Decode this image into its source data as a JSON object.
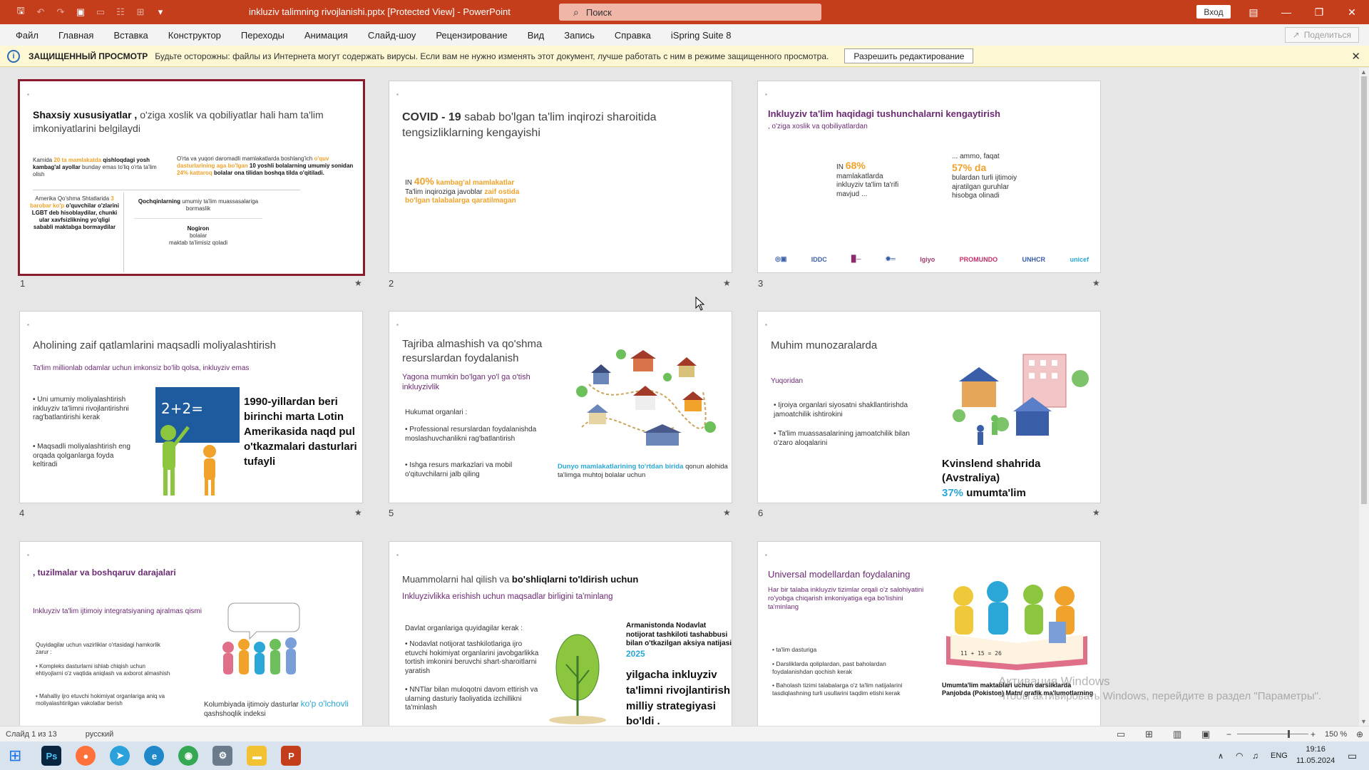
{
  "titlebar": {
    "doc_title": "inkluziv talimning rivojlanishi.pptx [Protected View] - PowerPoint",
    "search_placeholder": "Поиск",
    "signin": "Вход"
  },
  "ribbon": {
    "tabs": [
      "Файл",
      "Главная",
      "Вставка",
      "Конструктор",
      "Переходы",
      "Анимация",
      "Слайд-шоу",
      "Рецензирование",
      "Вид",
      "Запись",
      "Справка",
      "iSpring Suite 8"
    ],
    "share": "Поделиться"
  },
  "message_bar": {
    "label": "ЗАЩИЩЕННЫЙ ПРОСМОТР",
    "text": "Будьте осторожны: файлы из Интернета могут содержать вирусы. Если вам не нужно изменять этот документ, лучше работать с ним в режиме защищенного просмотра.",
    "button": "Разрешить редактирование"
  },
  "slides": {
    "s1": {
      "num": "1",
      "title_bold": "Shaxsiy xususiyatlar ,",
      "title_rest": " o'ziga xoslik va qobiliyatlar hali ham ta'lim imkoniyatlarini belgilaydi",
      "b1a": "Kamida ",
      "b1b": "20 ta mamlakatda",
      "b1c": " qishloqdagi yosh kambag'al ayollar",
      "b1d": " bunday emas to'liq o'rta ta'lim olish",
      "b2a": "O'rta va yuqori daromadli mamlakatlarda boshlang'ich ",
      "b2b": "o'quv dasturlarining aga bo'lgan ",
      "b2c": "10 yoshli bolalarning umumiy sonidan ",
      "b2d": "24% kattaroq",
      "b2e": " bolalar ona tilidan boshqa tilda o'qitiladi.",
      "b3a": "Amerika Qo'shma Shtatlarida ",
      "b3b": "3 barobar ko'p",
      "b3c": " o'quvchilar o'zlarini LGBT deb hisoblaydilar, chunki ular xavfsizlikning yo'qligi sababli maktabga bormaydilar",
      "b4a": "Qochqinlarning",
      "b4b": " umumiy ta'lim muassasalariga bormaslik",
      "b5a": "Nogiron",
      "b5b": "bolalar",
      "b5c": "maktab ta'limisiz qoladi"
    },
    "s2": {
      "num": "2",
      "title_a": "COVID - 19",
      "title_b": " sabab bo'lgan ta'lim inqirozi sharoitida tengsizliklarning kengayishi",
      "l1a": "IN ",
      "l1b": "40%",
      "l1c": " kambag'al mamlakatlar",
      "l2a": "Ta'lim inqiroziga javoblar ",
      "l2b": "zaif ostida",
      "l3": "bo'lgan talabalarga qaratilmagan"
    },
    "s3": {
      "num": "3",
      "title": "Inkluyziv ta'lim haqidagi tushunchalarni kengaytirish",
      "subtitle": ", o'ziga xoslik va qobiliyatlardan",
      "l1a": "IN ",
      "l1b": "68%",
      "l1c": "mamlakatlarda inkluyziv ta'lim ta'rifi mavjud ...",
      "r1": "... ammo, faqat",
      "r2": "57% da",
      "r3": "bulardan turli ijtimoiy ajratilgan guruhlar hisobga olinadi",
      "logos": [
        "IDDC",
        "Igiyo",
        "PROMUNDO",
        "UNHCR",
        "unicef"
      ]
    },
    "s4": {
      "num": "4",
      "title": "Aholining zaif qatlamlarini maqsadli moliyalashtirish",
      "subtitle": "Ta'lim millionlab odamlar uchun imkonsiz bo'lib qolsa, inkluyziv emas",
      "b1": "Uni umumiy moliyalashtirish inkluyziv ta'limni rivojlantirishni rag'batlantirishi kerak",
      "b2": "Maqsadli moliyalashtirish eng orqada qolganlarga foyda keltiradi",
      "board": "2+2=",
      "big": "1990-yillardan beri birinchi marta Lotin Amerikasida naqd pul o'tkazmalari dasturlari tufayli"
    },
    "s5": {
      "num": "5",
      "title": "Tajriba almashish va qo'shma resurslardan foydalanish",
      "subtitle": "Yagona mumkin bo'lgan yo'l ga o'tish inkluyzivlik",
      "head": "Hukumat organlari :",
      "b1": "Professional resurslardan foydalanishda moslashuvchanlikni rag'batlantirish",
      "b2": "Ishga resurs markazlari va mobil o'qituvchilarni jalb qiling",
      "foot_a": "Dunyo mamlakatlarining to'rtdan birida",
      "foot_b": " qonun alohida ta'limga muhtoj bolalar uchun"
    },
    "s6": {
      "num": "6",
      "title": "Muhim munozaralarda",
      "sub": "Yuqoridan",
      "b1": "Ijroiya organlari siyosatni shakllantirishda jamoatchilik ishtirokini",
      "b2": "Ta'lim muassasalarining jamoatchilik bilan o'zaro aloqalarini",
      "big1": "Kvinslend shahrida (Avstraliya)",
      "big2a": "37%",
      "big2b": " umumta'lim"
    },
    "s7": {
      "title": ", tuzilmalar va boshqaruv darajalari",
      "subtitle": "Inkluyziv ta'lim ijtimoiy integratsiyaning ajralmas qismi",
      "head": "Quyidagilar uchun vazirliklar o'rtasidagi hamkorlik zarur :",
      "b1": "Kompleks dasturlarni ishlab chiqish uchun ehtiyojlarni o'z vaqtida aniqlash va axborot almashish",
      "b2": "Mahalliy ijro etuvchi hokimiyat organlariga aniq va moliyalashtirilgan vakolatlar berish",
      "foot_a": "Kolumbiyada ijtimoiy dasturlar ",
      "foot_b": "ko'p o'lchovli",
      "foot_c": " qashshoqlik indeksi"
    },
    "s8": {
      "title_a": "Muammolarni hal qilish va ",
      "title_b": "bo'shliqlarni to'ldirish uchun",
      "subtitle": "Inkluyzivlikka erishish uchun maqsadlar birligini ta'minlang",
      "head": "Davlat organlariga quyidagilar kerak :",
      "b1": "Nodavlat notijorat tashkilotlariga ijro etuvchi hokimiyat organlarini javobgarlikka tortish imkonini beruvchi shart-sharoitlarni yaratish",
      "b2": "NNTlar bilan muloqotni davom ettirish va ularning dasturiy faoliyatida izchillikni ta'minlash",
      "r1": "Armanistonda Nodavlat notijorat tashkiloti tashabbusi bilan o'tkazilgan aksiya natijasi ",
      "r1b": "2025",
      "r2": "yilgacha inkluyziv ta'limni rivojlantirish milliy strategiyasi bo'ldi ."
    },
    "s9": {
      "title": "Universal modellardan foydalaning",
      "subtitle": "Har bir talaba inkluyziv tizimlar orqali o'z salohiyatini ro'yobga chiqarish imkoniyatiga ega bo'lishini ta'minlang",
      "b1": "ta'lim dasturiga",
      "b2": "Darsliklarda qoliplardan, past baholardan foydalanishdan qochish kerak",
      "b3": "Baholash tizimi talabalarga o'z ta'lim natijalarini tasdiqlashning turli usullarini taqdim etishi kerak",
      "foot": "Umumta'lim maktablari uchun darsliklarda Panjobda (Pokiston) Matn/ grafik ma'lumotlarning",
      "book": "11 + 15 = 26"
    }
  },
  "statusbar": {
    "slide_of": "Слайд 1 из 13",
    "lang": "русский",
    "zoom": "150 %"
  },
  "watermark": {
    "line1": "Активация Windows",
    "line2": "Чтобы активировать Windows, перейдите в раздел \"Параметры\"."
  },
  "taskbar": {
    "lang": "ENG",
    "time": "19:16",
    "date": "11.05.2024"
  },
  "colors": {
    "title_bar": "#c43e1c",
    "selection": "#8a1b2c",
    "accent_orange": "#f0a22a",
    "accent_blue": "#2aa7d6"
  }
}
